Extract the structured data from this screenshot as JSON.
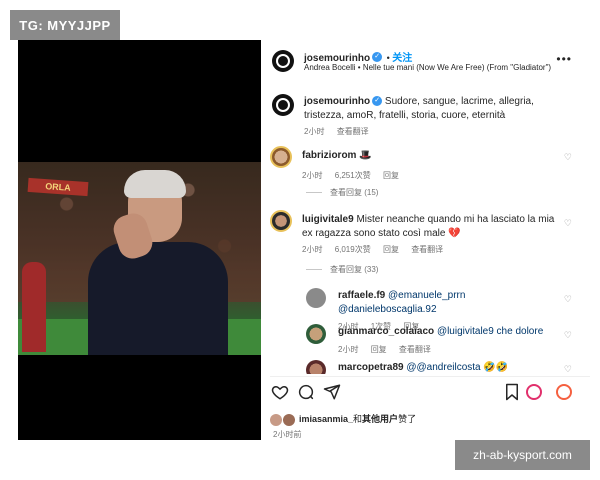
{
  "watermarks": {
    "top": "TG: MYYJJPP",
    "bottom": "zh-ab-kysport.com"
  },
  "post": {
    "username": "josemourinho",
    "follow_label": "关注",
    "song": "Andrea Bocelli • Nelle tue mani (Now We Are Free) (From \"Gladiator\")",
    "caption_user": "josemourinho",
    "caption_text": "Sudore, sangue, lacrime, allegria, tristezza, amoR, fratelli, storia, cuore, eternità",
    "caption_time": "2小时",
    "caption_translate": "查看翻译",
    "photo_banner": "ORLA"
  },
  "comments": [
    {
      "user": "fabriziorom",
      "text": "🎩",
      "time": "2小时",
      "likes": "6,251次赞",
      "reply": "回复",
      "view_replies": "查看回复 (15)"
    },
    {
      "user": "luigivitale9",
      "text": "Mister neanche quando mi ha lasciato la mia ex ragazza sono stato così male 💔",
      "time": "2小时",
      "likes": "6,019次赞",
      "reply": "回复",
      "translate": "查看翻译",
      "view_replies": "查看回复 (33)"
    }
  ],
  "replies": [
    {
      "user": "raffaele.f9",
      "text": "@emanuele_prrn @danieleboscaglia.92",
      "time": "2小时",
      "likes": "1次赞",
      "reply": "回复"
    },
    {
      "user": "gianmarco_colaiaco",
      "text": "@luigivitale9 che dolore",
      "time": "2小时",
      "reply": "回复",
      "translate": "查看翻译"
    },
    {
      "user": "marcopetra89",
      "text": "@@andreilcosta 🤣🤣"
    }
  ],
  "footer": {
    "likes_user": "imiasanmia_",
    "likes_connector": "和",
    "likes_others": "其他用户",
    "likes_suffix": "赞了",
    "time": "2小时前"
  }
}
